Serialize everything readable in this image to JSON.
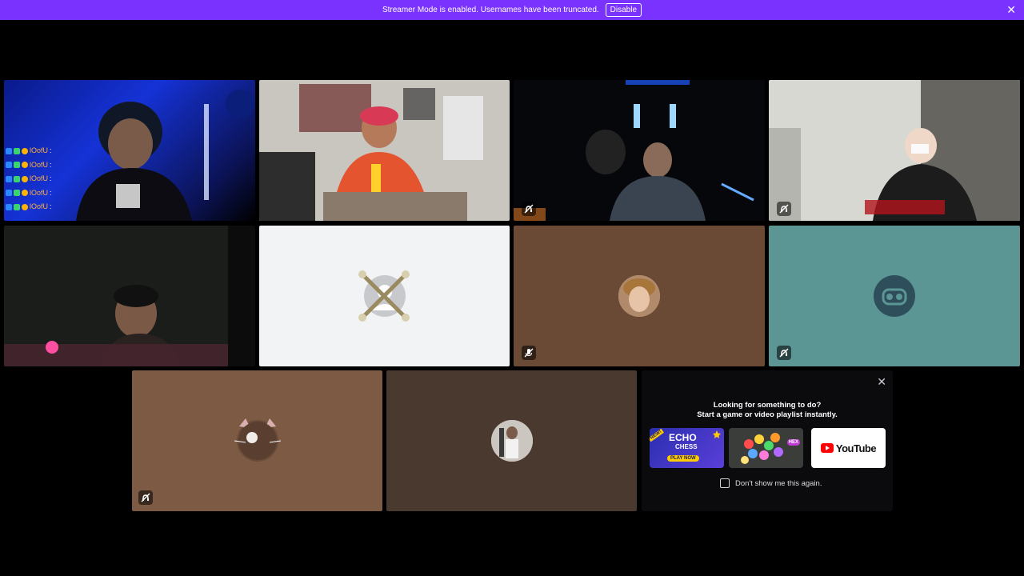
{
  "banner": {
    "message": "Streamer Mode is enabled. Usernames have been truncated.",
    "disable_label": "Disable",
    "close_icon": "close-icon",
    "color": "#7a33ff"
  },
  "chat_overlay": {
    "lines": [
      {
        "user": "lOofU",
        "sep": ":"
      },
      {
        "user": "lOofU",
        "sep": ":"
      },
      {
        "user": "lOofU",
        "sep": ":"
      },
      {
        "user": "lOofU",
        "sep": ":"
      },
      {
        "user": "lOofU",
        "sep": ":"
      }
    ]
  },
  "tiles": [
    {
      "type": "video",
      "selected": false
    },
    {
      "type": "video",
      "selected": true
    },
    {
      "type": "video",
      "muted": true
    },
    {
      "type": "video",
      "muted": true
    },
    {
      "type": "video"
    },
    {
      "type": "avatar",
      "bg": "#f2f3f5"
    },
    {
      "type": "avatar",
      "bg": "#6b4a35",
      "muted": true
    },
    {
      "type": "avatar",
      "bg": "#5b9594",
      "deafened": true
    },
    {
      "type": "avatar",
      "bg": "#7c5a44",
      "deafened": true
    },
    {
      "type": "avatar",
      "bg": "#4a392e"
    }
  ],
  "activity": {
    "title": "Looking for something to do?",
    "subtitle": "Start a game or video playlist instantly.",
    "cards": [
      {
        "name": "echo-chess",
        "badge": "NEW!",
        "title": "ECHO",
        "title2": "CHESS",
        "cta": "PLAY NOW"
      },
      {
        "name": "gems",
        "badge": "HEX"
      },
      {
        "name": "youtube",
        "label": "YouTube"
      }
    ],
    "dont_show_label": "Don't show me this again."
  }
}
